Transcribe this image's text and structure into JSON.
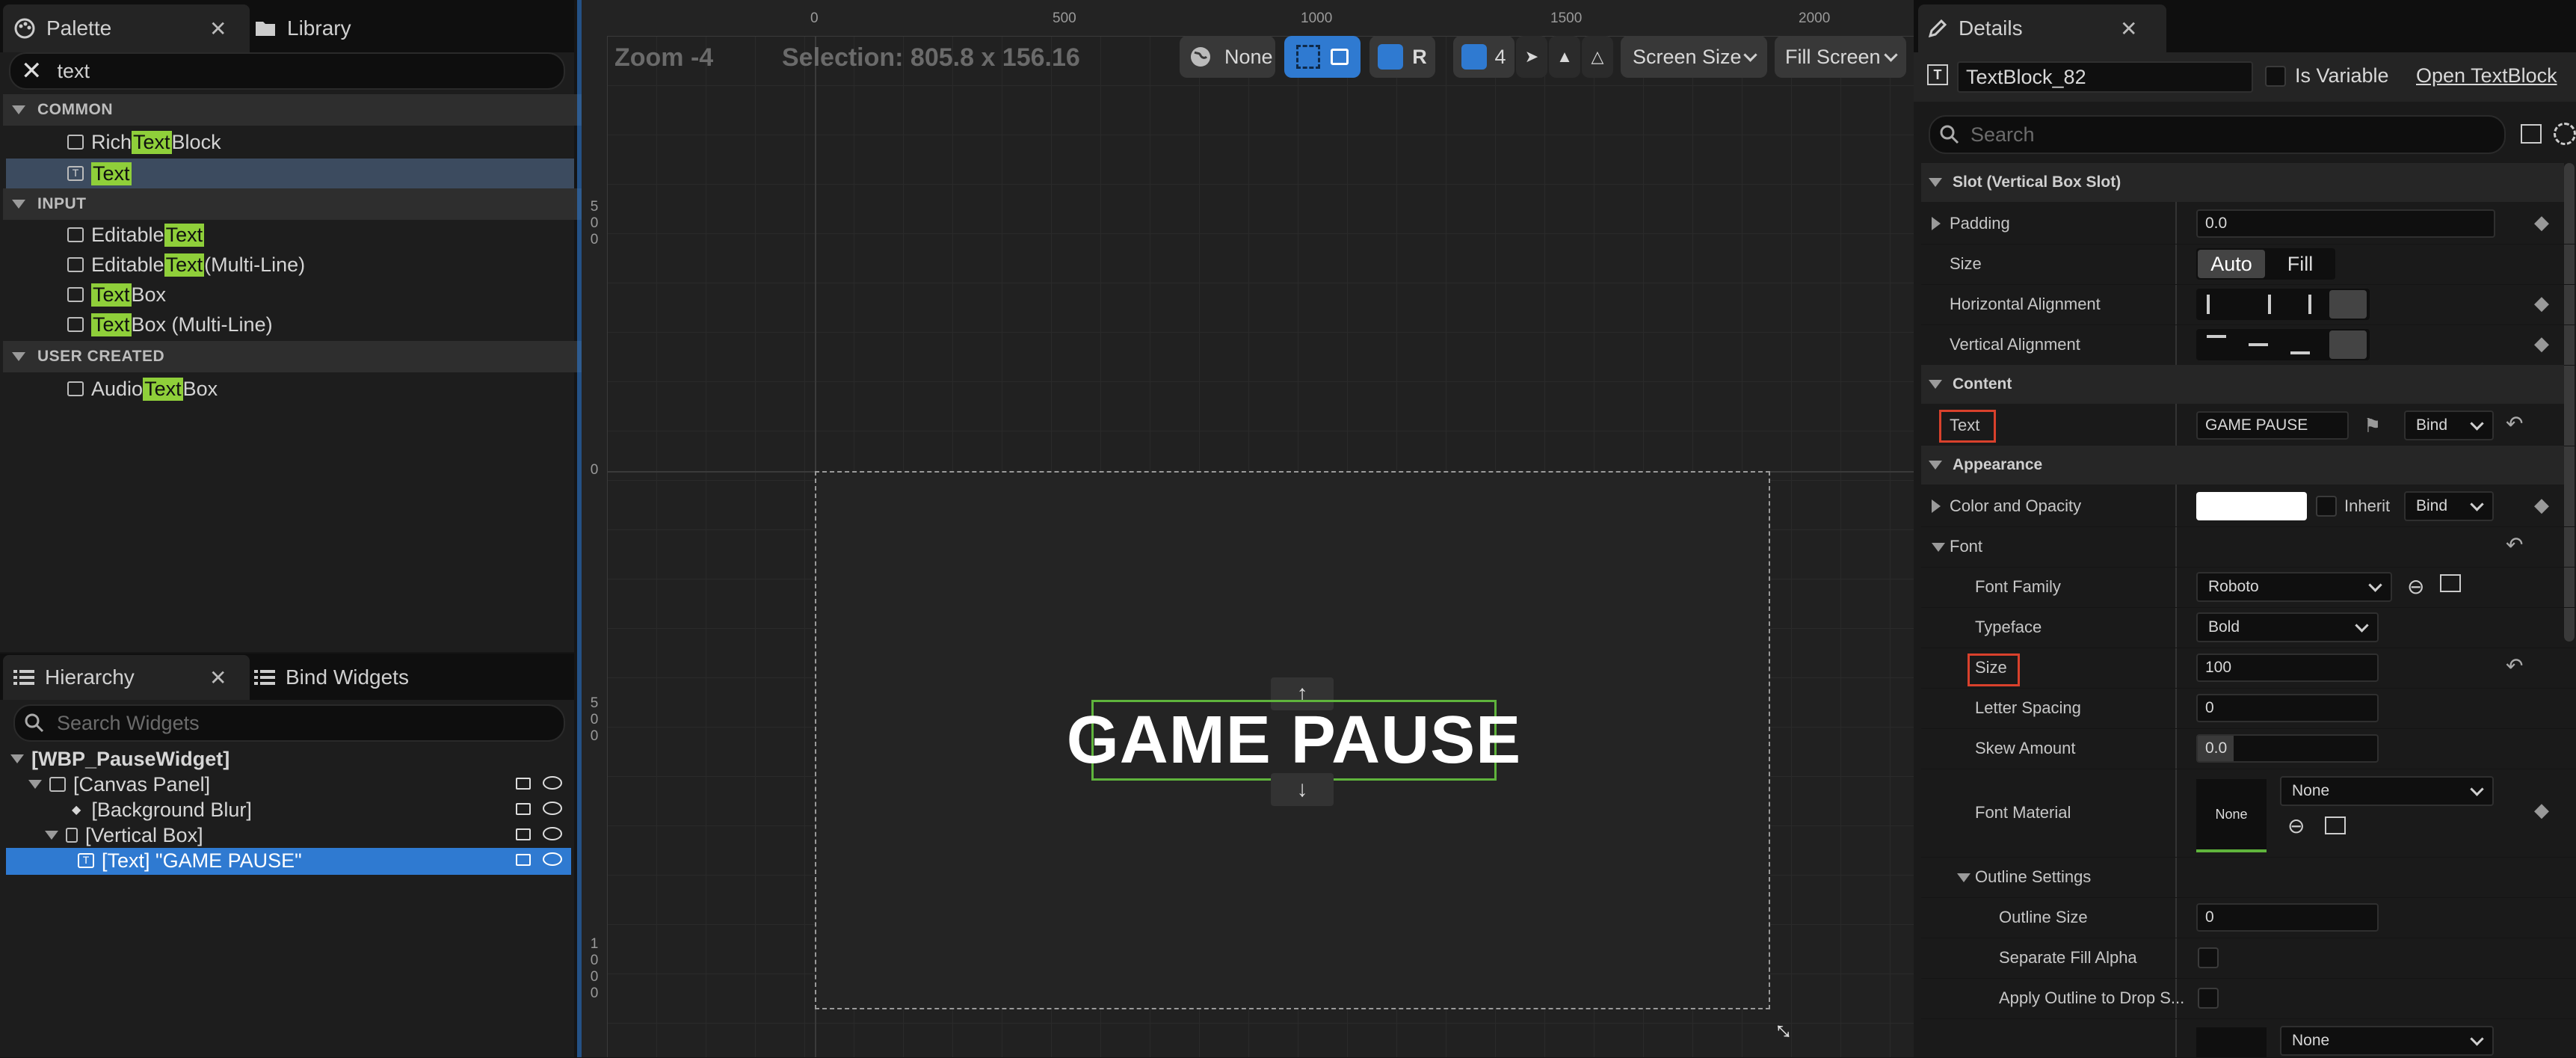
{
  "palette": {
    "tab_label": "Palette",
    "library_tab_label": "Library",
    "search_value": "text",
    "categories": {
      "common": "COMMON",
      "input": "INPUT",
      "user_created": "USER CREATED"
    },
    "items": [
      {
        "pre": "Rich ",
        "hl": "Text",
        "post": " Block"
      },
      {
        "pre": "",
        "hl": "Text",
        "post": ""
      },
      {
        "pre": "Editable ",
        "hl": "Text",
        "post": ""
      },
      {
        "pre": "Editable ",
        "hl": "Text",
        "post": " (Multi-Line)"
      },
      {
        "pre": "",
        "hl": "Text",
        "post": " Box"
      },
      {
        "pre": "",
        "hl": "Text",
        "post": " Box (Multi-Line)"
      },
      {
        "pre": "Audio ",
        "hl": "Text",
        "post": " Box"
      }
    ]
  },
  "hierarchy": {
    "tab_label": "Hierarchy",
    "bind_tab_label": "Bind Widgets",
    "search_placeholder": "Search Widgets",
    "rows": [
      "[WBP_PauseWidget]",
      "[Canvas Panel]",
      "[Background Blur]",
      "[Vertical Box]",
      "[Text] \"GAME PAUSE\""
    ]
  },
  "viewport": {
    "zoom_label": "Zoom -4",
    "selection_label": "Selection: 805.8 x 156.16",
    "locale_label": "None",
    "r_label": "R",
    "grid_value": "4",
    "screen_size_label": "Screen Size",
    "fill_screen_label": "Fill Screen",
    "ruler_h": [
      "0",
      "500",
      "1000",
      "1500",
      "2000"
    ],
    "ruler_v_top": [
      "5",
      "0",
      "0"
    ],
    "ruler_v_zero": "0",
    "ruler_v_mid": [
      "5",
      "0",
      "0"
    ],
    "ruler_v_bot": [
      "1",
      "0",
      "0",
      "0"
    ],
    "widget_text": "GAME PAUSE"
  },
  "details": {
    "tab_label": "Details",
    "widget_name": "TextBlock_82",
    "is_variable_label": "Is Variable",
    "open_link": "Open TextBlock",
    "search_placeholder": "Search",
    "sections": {
      "slot": "Slot (Vertical Box Slot)",
      "content": "Content",
      "appearance": "Appearance"
    },
    "padding_label": "Padding",
    "padding_value": "0.0",
    "size_label": "Size",
    "size_auto": "Auto",
    "size_fill": "Fill",
    "h_align_label": "Horizontal Alignment",
    "v_align_label": "Vertical Alignment",
    "text_label": "Text",
    "text_value": "GAME PAUSE",
    "bind_label": "Bind",
    "color_label": "Color and Opacity",
    "inherit_label": "Inherit",
    "font_label": "Font",
    "font_family_label": "Font Family",
    "font_family_value": "Roboto",
    "typeface_label": "Typeface",
    "typeface_value": "Bold",
    "font_size_label": "Size",
    "font_size_value": "100",
    "letter_spacing_label": "Letter Spacing",
    "letter_spacing_value": "0",
    "skew_label": "Skew Amount",
    "skew_value": "0.0",
    "font_material_label": "Font Material",
    "font_material_thumb": "None",
    "font_material_value": "None",
    "outline_settings_label": "Outline Settings",
    "outline_size_label": "Outline Size",
    "outline_size_value": "0",
    "separate_fill_label": "Separate Fill Alpha",
    "apply_outline_label": "Apply Outline to Drop S...",
    "outline_material_value": "None"
  },
  "colors": {
    "highlight": "#8fcf3a",
    "selection_blue": "#2f7ad1",
    "red_box": "#d9412c",
    "widget_outline": "#5fb43c"
  }
}
